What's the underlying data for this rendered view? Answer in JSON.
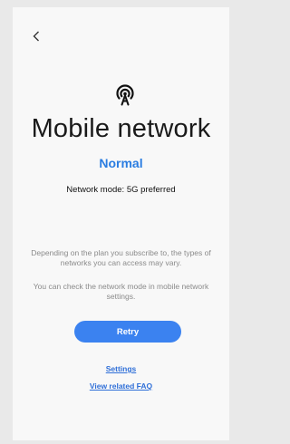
{
  "header": {
    "back_icon": "chevron-left-icon"
  },
  "main": {
    "icon": "signal-tower-icon",
    "title": "Mobile network",
    "status": "Normal",
    "network_mode": "Network mode: 5G preferred",
    "description_1": "Depending on the plan you subscribe to, the types of networks you can access may vary.",
    "description_2": "You can check the network mode in mobile network settings.",
    "retry_label": "Retry",
    "settings_link": "Settings",
    "faq_link": "View related FAQ"
  },
  "colors": {
    "accent": "#3b82f0",
    "status_text": "#2a7de1",
    "link": "#2f6fd8",
    "background": "#f8f8f8"
  }
}
